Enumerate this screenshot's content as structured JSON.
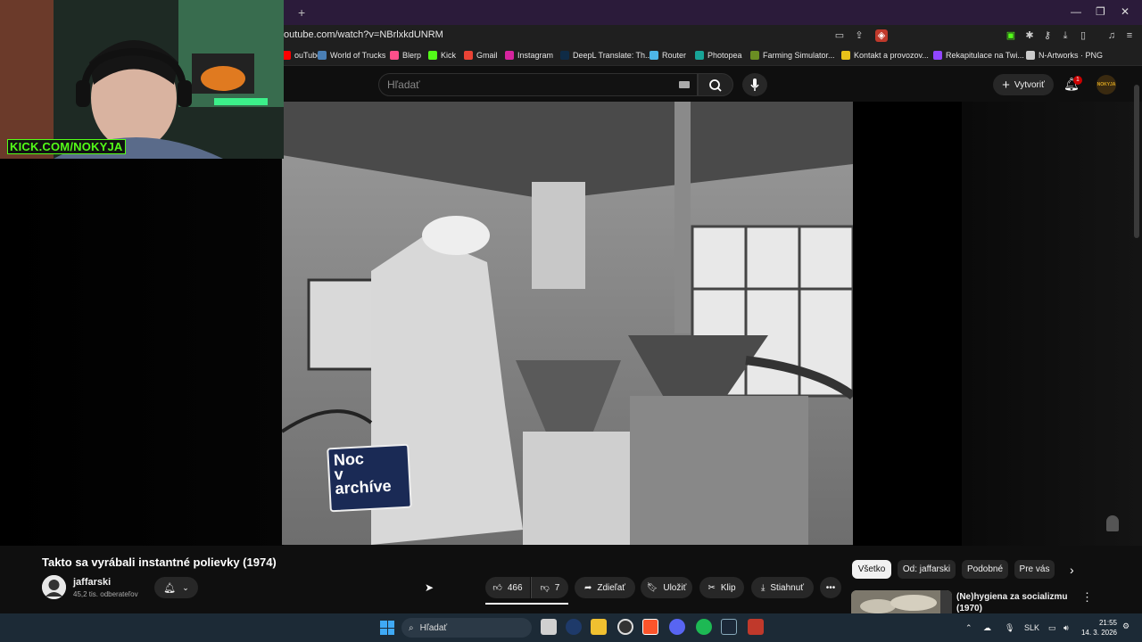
{
  "browser": {
    "url": "outube.com/watch?v=NBrlxkdUNRM",
    "new_tab_symbol": "+",
    "bookmarks": [
      {
        "label": "ouTube",
        "color": "#ff0000"
      },
      {
        "label": "World of Trucks",
        "color": "#4a7fb5"
      },
      {
        "label": "Blerp",
        "color": "#ff4f8b"
      },
      {
        "label": "Kick",
        "color": "#53fc18"
      },
      {
        "label": "Gmail",
        "color": "#ea4335"
      },
      {
        "label": "Instagram",
        "color": "#d6249f"
      },
      {
        "label": "DeepL Translate: Th...",
        "color": "#0f2b46"
      },
      {
        "label": "Router",
        "color": "#4db6e8"
      },
      {
        "label": "Photopea",
        "color": "#18a497"
      },
      {
        "label": "Farming Simulator...",
        "color": "#6b8e23"
      },
      {
        "label": "Kontakt a provozov...",
        "color": "#e8c21a"
      },
      {
        "label": "Rekapitulace na Twi...",
        "color": "#9146ff"
      },
      {
        "label": "N-Artworks · PNG",
        "color": "#cccccc"
      }
    ]
  },
  "webcam": {
    "overlay_text": "KICK.COM/NOKYJA"
  },
  "youtube": {
    "search_placeholder": "Hľadať",
    "create_label": "Vytvoriť",
    "notification_count": "1",
    "profile_text": "NOKYJA",
    "video_overlay": [
      "Noc",
      "v",
      "archíve"
    ],
    "video_title": "Takto sa vyrábali instantné polievky (1974)",
    "channel_name": "jaffarski",
    "subscribers": "45,2 tis. odberateľov",
    "likes": "466",
    "dislikes": "7",
    "share_label": "Zdieľať",
    "save_label": "Uložiť",
    "clip_label": "Klip",
    "download_label": "Stiahnuť",
    "chips": [
      "Všetko",
      "Od: jaffarski",
      "Podobné",
      "Pre vás"
    ],
    "recommendation_title": "(Ne)hygiena za socializmu (1970)"
  },
  "taskbar": {
    "search_label": "Hľadať",
    "language": "SLK",
    "time": "21:55",
    "date": "14. 3. 2026"
  }
}
